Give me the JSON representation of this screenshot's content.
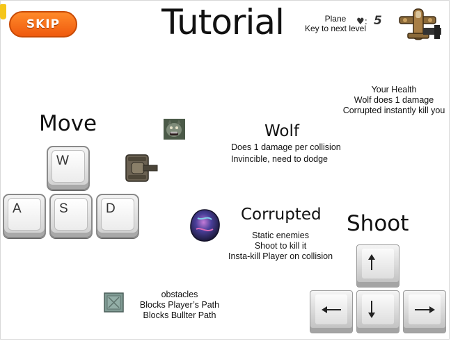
{
  "header": {
    "skip_label": "SKIP",
    "title": "Tutorial",
    "plane_line1": "Plane",
    "plane_line2": "Key to next level",
    "lives_icon": "heart-icon",
    "lives_value": "5"
  },
  "health": {
    "line1": "Your Health",
    "line2": "Wolf does 1 damage",
    "line3": "Corrupted instantly kill you"
  },
  "move": {
    "heading": "Move",
    "keys": [
      "W",
      "A",
      "S",
      "D"
    ]
  },
  "wolf": {
    "heading": "Wolf",
    "line1": "Does 1 damage per collision",
    "line2": "Invincible, need to dodge"
  },
  "corrupted": {
    "heading": "Corrupted",
    "line1": "Static enemies",
    "line2": "Shoot to kill it",
    "line3": "Insta-kill Player on collision"
  },
  "shoot": {
    "heading": "Shoot",
    "keys": [
      "up-arrow",
      "left-arrow",
      "down-arrow",
      "right-arrow"
    ]
  },
  "obstacles": {
    "line1": "obstacles",
    "line2": "Blocks Player’s Path",
    "line3": "Blocks Bullter Path"
  },
  "colors": {
    "skip_button": "#f26a16",
    "tank": "#5b5346",
    "obstacle": "#7f9a93",
    "corrupted_blob": "#3d3b8e"
  }
}
